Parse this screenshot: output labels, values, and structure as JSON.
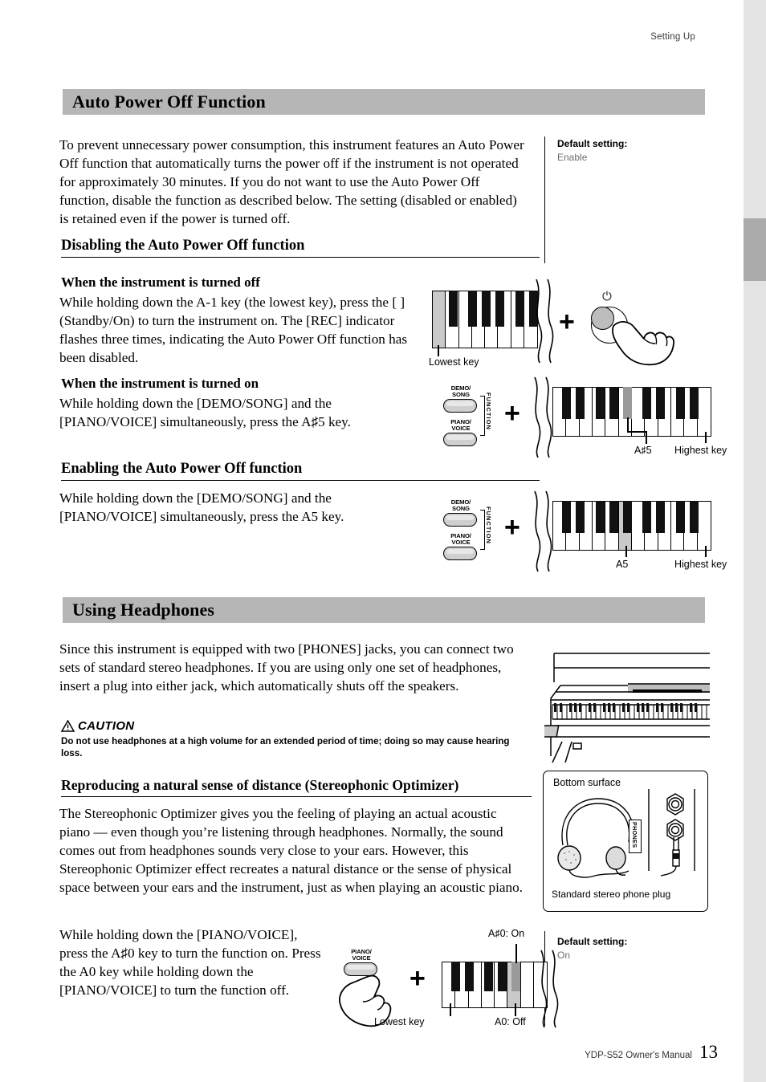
{
  "meta": {
    "running_header": "Setting Up",
    "footer_manual": "YDP-S52 Owner's Manual",
    "footer_page": "13"
  },
  "sections": [
    {
      "id": "auto-power-off",
      "title": "Auto Power Off Function",
      "intro": "To prevent unnecessary power consumption, this instrument features an Auto Power Off function that automatically turns the power off if the instrument is not operated for approximately 30 minutes. If you do not want to use the Auto Power Off function, disable the function as described below. The setting (disabled or enabled) is retained even if the power is turned off.",
      "note": {
        "label": "Default setting:",
        "value": "Enable"
      },
      "sub_disabling": {
        "heading": "Disabling the Auto Power Off function",
        "case_off": {
          "heading": "When the instrument is turned off",
          "text": "While holding down the A-1 key (the lowest key), press the [    ] (Standby/On) to turn the instrument on. The [REC] indicator flashes three times, indicating the Auto Power Off function has been disabled."
        },
        "case_on": {
          "heading": "When the instrument is turned on",
          "text": "While holding down the [DEMO/SONG] and the [PIANO/VOICE] simultaneously, press the A♯5 key."
        }
      },
      "sub_enabling": {
        "heading": "Enabling the Auto Power Off function",
        "text": "While holding down the [DEMO/SONG] and the [PIANO/VOICE] simultaneously, press the A5 key."
      }
    },
    {
      "id": "using-headphones",
      "title": "Using Headphones",
      "intro": "Since this instrument is equipped with two [PHONES] jacks, you can connect two sets of standard stereo headphones. If you are using only one set of headphones, insert a plug into either jack, which automatically shuts off the speakers.",
      "caution": {
        "label": "CAUTION",
        "text": "Do not use headphones at a high volume for an extended period of time; doing so may cause hearing loss."
      },
      "optimizer": {
        "heading": "Reproducing a natural sense of distance (Stereophonic Optimizer)",
        "text": "The Stereophonic Optimizer gives you the feeling of playing an actual acoustic piano — even though you’re listening through headphones. Normally, the sound comes out from headphones sounds very close to your ears. However, this Stereophonic Optimizer effect recreates a natural distance or the sense of physical space between your ears and the instrument, just as when playing an acoustic piano.",
        "operation": "While holding down the [PIANO/VOICE], press the A♯0 key to turn the function on. Press the A0 key while holding down the [PIANO/VOICE] to turn the function off.",
        "note": {
          "label": "Default setting:",
          "value": "On"
        }
      },
      "jack_figure": {
        "bottom_surface": "Bottom surface",
        "phones_label": "PHONES",
        "plug_label": "Standard stereo phone plug"
      }
    }
  ],
  "diagrams": {
    "d1": {
      "key_label": "Lowest key",
      "plus": "+",
      "power_glyph": "⏻"
    },
    "d2": {
      "btn_top": "DEMO/\nSONG",
      "btn_bottom": "PIANO/\nVOICE",
      "function_word": "FUNCTION",
      "plus": "+",
      "key_label": "A♯5",
      "edge_label": "Highest key"
    },
    "d3": {
      "btn_top": "DEMO/\nSONG",
      "btn_bottom": "PIANO/\nVOICE",
      "function_word": "FUNCTION",
      "plus": "+",
      "key_label": "A5",
      "edge_label": "Highest key"
    },
    "d4": {
      "btn": "PIANO/\nVOICE",
      "plus": "+",
      "label_on": "A♯0: On",
      "label_off": "A0: Off",
      "key_label": "Lowest key"
    }
  },
  "colors": {
    "section_bar": "#b6b6b6",
    "edge_strip": "#e4e4e4",
    "edge_tab": "#aaaaaa",
    "key_highlight_white": "#c9c9c9",
    "key_highlight_black": "#9a9a9a",
    "note_value": "#6d6d6d"
  }
}
